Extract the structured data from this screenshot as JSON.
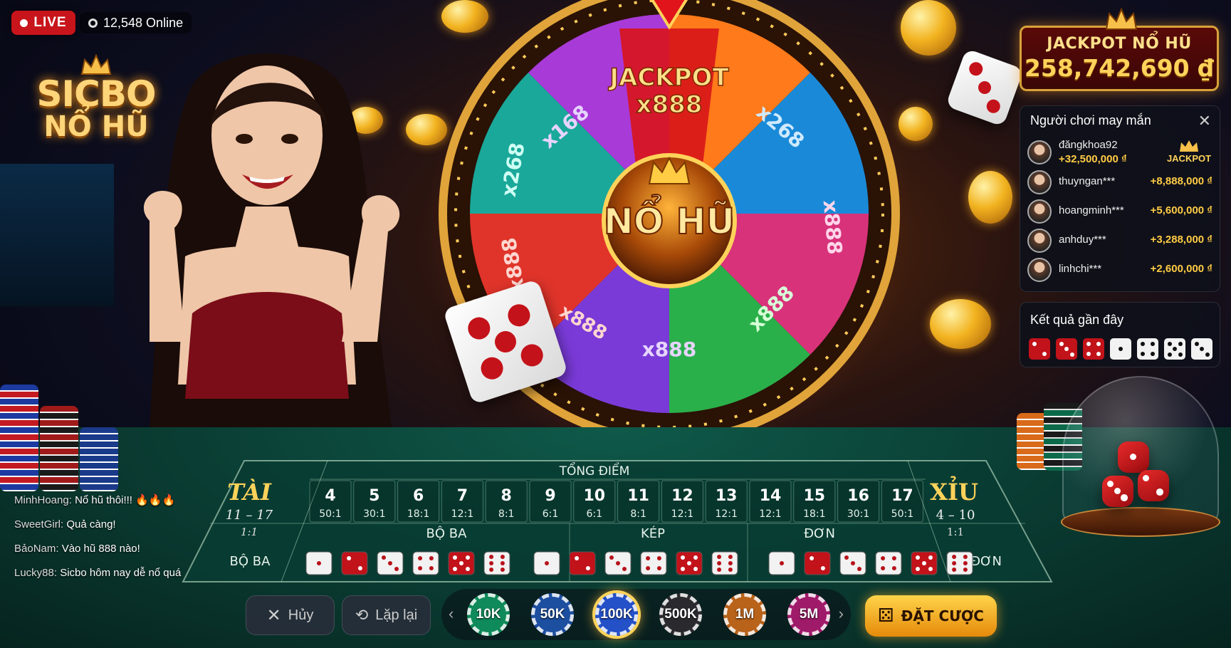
{
  "top": {
    "live_label": "LIVE",
    "online_text": "12,548 Online"
  },
  "logo": {
    "line1": "SICBO",
    "line2": "NỔ HŨ"
  },
  "wheel": {
    "center_label": "NỔ HŨ",
    "jackpot_segment": {
      "line1": "JACKPOT",
      "line2": "x888"
    },
    "segments": [
      "x168",
      "x268",
      "x888",
      "x888",
      "x888",
      "x888",
      "x268",
      "x888"
    ]
  },
  "jackpot": {
    "title": "JACKPOT NỔ HŨ",
    "amount": "258,742,690 ₫"
  },
  "lucky_players": {
    "title": "Người chơi may mắn",
    "close_glyph": "✕",
    "first": {
      "name": "đăngkhoa92",
      "amount": "+32,500,000 ₫",
      "badge": "JACKPOT"
    },
    "rows": [
      {
        "name": "thuyngan***",
        "amount": "+8,888,000 ₫"
      },
      {
        "name": "hoangminh***",
        "amount": "+5,600,000 ₫"
      },
      {
        "name": "anhduy***",
        "amount": "+3,288,000 ₫"
      },
      {
        "name": "linhchi***",
        "amount": "+2,600,000 ₫"
      }
    ]
  },
  "recent_results": {
    "title": "Kết quả gần đây",
    "dice": [
      {
        "color": "red",
        "face": 2
      },
      {
        "color": "red",
        "face": 3
      },
      {
        "color": "red",
        "face": 4
      },
      {
        "color": "white",
        "face": 1
      },
      {
        "color": "white",
        "face": 4
      },
      {
        "color": "white",
        "face": 5
      },
      {
        "color": "white",
        "face": 3
      }
    ]
  },
  "board": {
    "total_header": "TỔNG ĐIỂM",
    "tai": {
      "label": "TÀI",
      "range": "11 – 17",
      "odds": "1:1"
    },
    "xiu": {
      "label": "XỈU",
      "range": "4 – 10",
      "odds": "1:1"
    },
    "totals": [
      {
        "n": "4",
        "odds": "50:1"
      },
      {
        "n": "5",
        "odds": "30:1"
      },
      {
        "n": "6",
        "odds": "18:1"
      },
      {
        "n": "7",
        "odds": "12:1"
      },
      {
        "n": "8",
        "odds": "8:1"
      },
      {
        "n": "9",
        "odds": "6:1"
      },
      {
        "n": "10",
        "odds": "6:1"
      },
      {
        "n": "11",
        "odds": "8:1"
      },
      {
        "n": "12",
        "odds": "12:1"
      },
      {
        "n": "13",
        "odds": "12:1"
      },
      {
        "n": "14",
        "odds": "12:1"
      },
      {
        "n": "15",
        "odds": "18:1"
      },
      {
        "n": "16",
        "odds": "30:1"
      },
      {
        "n": "17",
        "odds": "50:1"
      }
    ],
    "left_label": "BỘ BA",
    "right_label": "ĐƠN",
    "section_bo_ba": "BỘ BA",
    "section_kep": "KÉP",
    "section_don": "ĐƠN"
  },
  "chat": [
    {
      "user": "MinhHoang:",
      "text": "Nổ hũ thôi!!! 🔥🔥🔥"
    },
    {
      "user": "SweetGirl:",
      "text": "Quả càng!"
    },
    {
      "user": "BảoNam:",
      "text": "Vào hũ 888 nào!"
    },
    {
      "user": "Lucky88:",
      "text": "Sicbo hôm nay dễ nổ quá"
    }
  ],
  "controls": {
    "cancel_label": "Hủy",
    "repeat_label": "Lặp lại",
    "chips": [
      {
        "label": "10K",
        "color": "#0f8a5a"
      },
      {
        "label": "50K",
        "color": "#1d4fa0"
      },
      {
        "label": "100K",
        "color": "#2450c8",
        "selected": true
      },
      {
        "label": "500K",
        "color": "#2a2a2e"
      },
      {
        "label": "1M",
        "color": "#b8621a"
      },
      {
        "label": "5M",
        "color": "#a01a6a"
      }
    ],
    "bet_label": "ĐẶT CƯỢC"
  },
  "colors": {
    "accent_gold": "#ffd35a",
    "felt_green": "#0a3d33",
    "live_red": "#c8141b"
  }
}
